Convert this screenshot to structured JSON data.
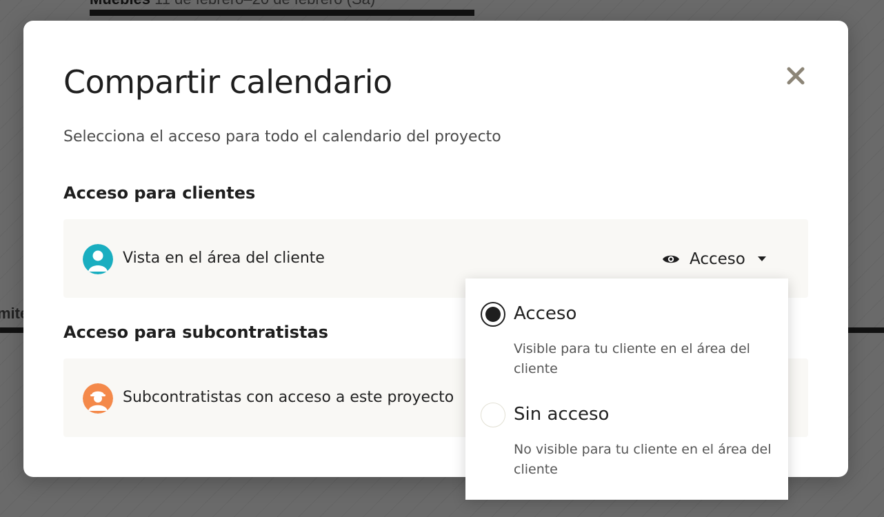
{
  "background": {
    "top_text_bold": "Muebles",
    "top_text_rest": "11 de febrero–20 de febrero (Sa)",
    "left_word": "mite"
  },
  "modal": {
    "title": "Compartir calendario",
    "subtitle": "Selecciona el acceso para todo el calendario del proyecto",
    "close_icon": "close-icon",
    "clients_section": {
      "title": "Acceso para clientes",
      "row_label": "Vista en el área del cliente",
      "access_value": "Acceso",
      "avatar_color": "#1aaec0"
    },
    "subcontractors_section": {
      "title": "Acceso para subcontratistas",
      "row_label": "Subcontratistas con acceso a este proyecto",
      "avatar_color": "#f4894a"
    }
  },
  "dropdown": {
    "options": [
      {
        "label": "Acceso",
        "description": "Visible para tu cliente en el área del cliente",
        "selected": true
      },
      {
        "label": "Sin acceso",
        "description": "No visible para tu cliente en el área del cliente",
        "selected": false
      }
    ]
  }
}
